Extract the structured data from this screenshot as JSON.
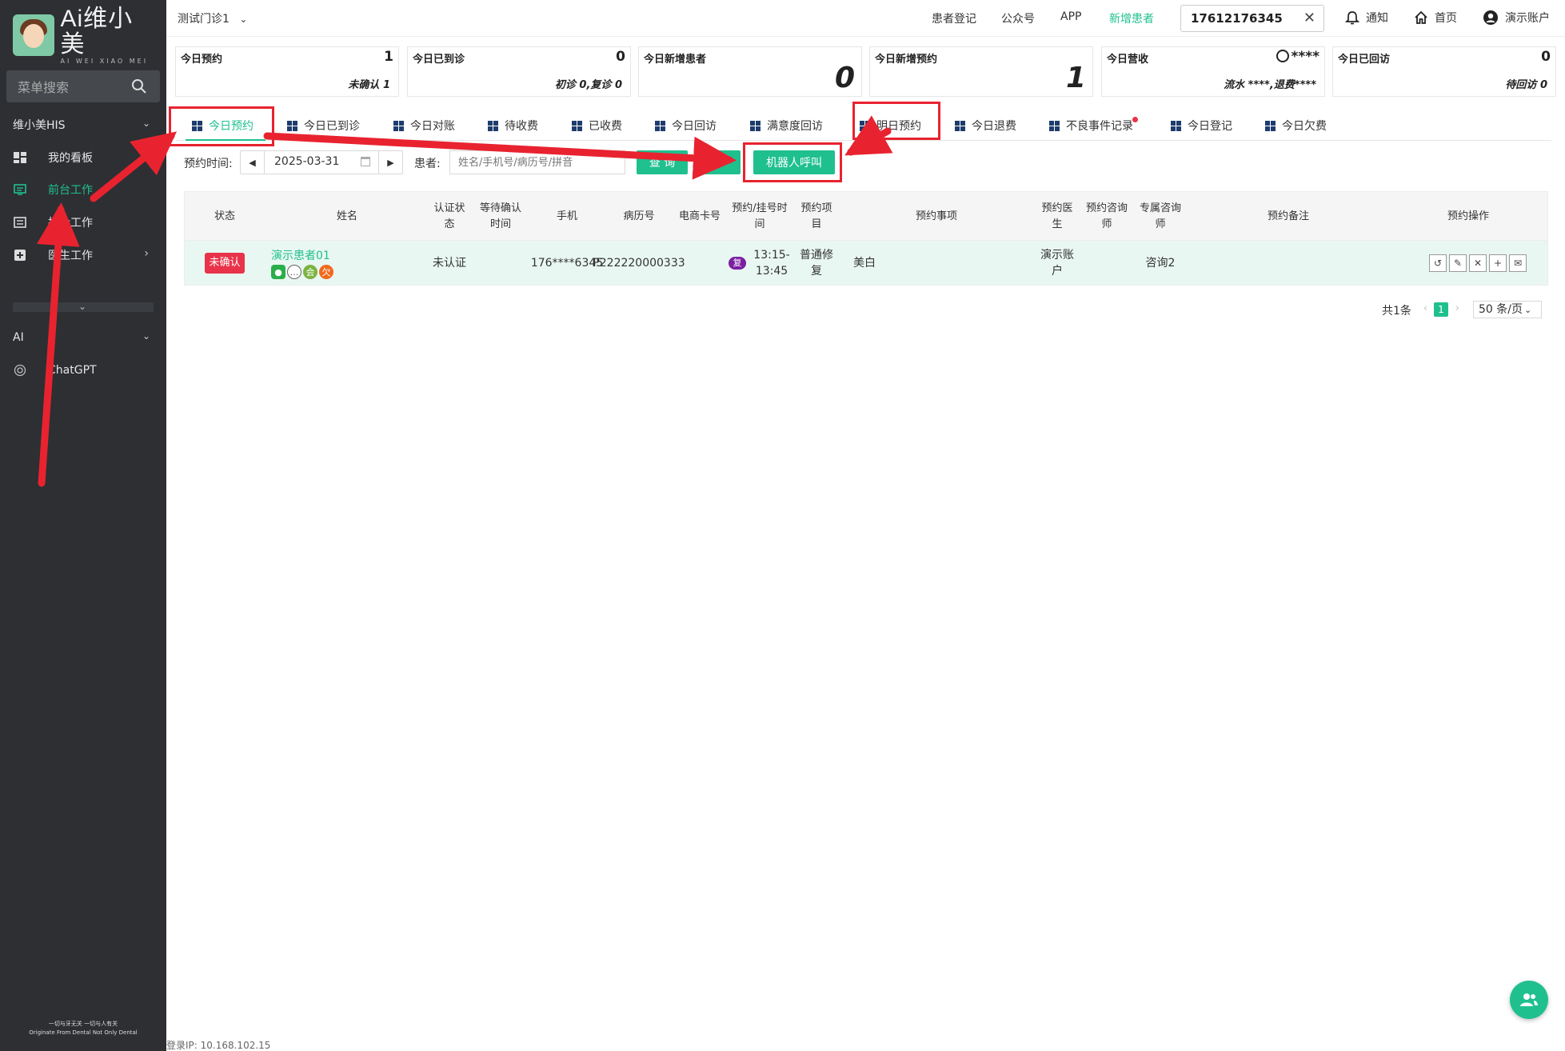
{
  "sidebar": {
    "logo_text": "Ai维小美",
    "logo_sub": "AI WEI XIAO MEI",
    "search_placeholder": "菜单搜索",
    "groups": [
      {
        "label": "维小美HIS"
      },
      {
        "label": "AI"
      }
    ],
    "items": [
      {
        "label": "我的看板"
      },
      {
        "label": "前台工作"
      },
      {
        "label": "护士工作"
      },
      {
        "label": "医生工作"
      },
      {
        "label": "ChatGPT"
      }
    ],
    "slogan_line1": "一切与牙无关 一切与人有关",
    "slogan_line2": "Originate From Dental Not Only Dental"
  },
  "topbar": {
    "store": "测试门诊1",
    "links": [
      "患者登记",
      "公众号",
      "APP",
      "新增患者"
    ],
    "phone": "17612176345",
    "notify": "通知",
    "home": "首页",
    "account": "演示账户"
  },
  "stats": [
    {
      "label": "今日预约",
      "value": "1",
      "sub": "未确认 1"
    },
    {
      "label": "今日已到诊",
      "value": "0",
      "sub": "初诊 0,复诊 0"
    },
    {
      "label": "今日新增患者",
      "value": "0"
    },
    {
      "label": "今日新增预约",
      "value": "1"
    },
    {
      "label": "今日营收",
      "value": "****",
      "sub": "流水 ****,退费****"
    },
    {
      "label": "今日已回访",
      "value": "0",
      "sub": "待回访 0"
    }
  ],
  "tabs": [
    "今日预约",
    "今日已到诊",
    "今日对账",
    "待收费",
    "已收费",
    "今日回访",
    "满意度回访",
    "明日预约",
    "今日退费",
    "不良事件记录",
    "今日登记",
    "今日欠费"
  ],
  "filter": {
    "date_label": "预约时间:",
    "date_value": "2025-03-31",
    "patient_label": "患者:",
    "patient_placeholder": "姓名/手机号/病历号/拼音",
    "query_button": "查 询",
    "robot_button": "机器人呼叫"
  },
  "table": {
    "headers": [
      "状态",
      "姓名",
      "认证状态",
      "等待确认时间",
      "手机",
      "病历号",
      "电商卡号",
      "预约/挂号时间",
      "预约项目",
      "预约事项",
      "预约医生",
      "预约咨询师",
      "专属咨询师",
      "预约备注",
      "预约操作"
    ],
    "rows": [
      {
        "status": "未确认",
        "name": "演示患者01",
        "badge_member": "会",
        "badge_debt": "欠",
        "auth": "未认证",
        "wait": "",
        "phone": "176****6345",
        "record": "P222220000333",
        "ecard": "",
        "revisit_badge": "复",
        "time": "13:15-13:45",
        "project": "普通修复",
        "matter": "美白",
        "doctor": "演示账户",
        "consultant": "",
        "exclusive": "咨询2",
        "remark": ""
      }
    ]
  },
  "pager": {
    "total": "共1条",
    "page": "1",
    "size": "50 条/页"
  },
  "login_ip": "登录IP: 10.168.102.15",
  "colors": {
    "accent": "#1fc08e",
    "sidebar": "#2d2f33",
    "annotation": "#e8232f",
    "status_red": "#e8334a"
  },
  "icons": [
    "search-icon",
    "dashboard-icon",
    "frontdesk-icon",
    "nurse-icon",
    "doctor-icon",
    "openai-icon",
    "bell-icon",
    "home-icon",
    "user-icon",
    "close-icon",
    "grid-icon",
    "calendar-icon",
    "wechat-icon",
    "chat-icon",
    "checkin-icon",
    "edit-icon",
    "cancel-icon",
    "add-icon",
    "message-icon",
    "people-icon"
  ]
}
